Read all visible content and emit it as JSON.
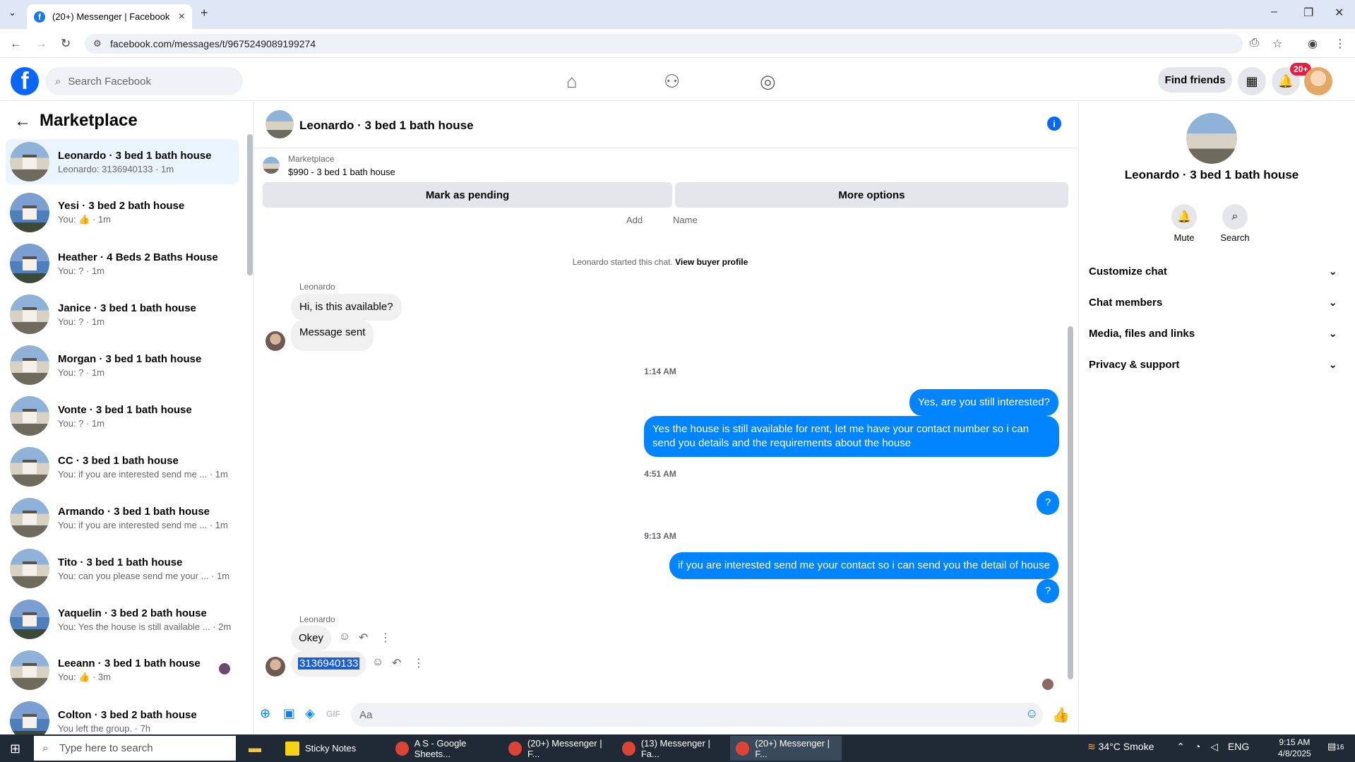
{
  "browser": {
    "tab_title": "(20+) Messenger | Facebook",
    "url": "facebook.com/messages/t/9675249089199274"
  },
  "header": {
    "search_placeholder": "Search Facebook",
    "find_friends": "Find friends",
    "notif_badge": "20+"
  },
  "left": {
    "title": "Marketplace",
    "conversations": [
      {
        "name": "Leonardo · 3 bed 1 bath house",
        "sub": "Leonardo: 3136940133 · 1m"
      },
      {
        "name": "Yesi · 3 bed 2 bath house",
        "sub": "You: 👍 · 1m"
      },
      {
        "name": "Heather · 4 Beds 2 Baths House",
        "sub": "You: ? · 1m"
      },
      {
        "name": "Janice · 3 bed 1 bath house",
        "sub": "You: ? · 1m"
      },
      {
        "name": "Morgan · 3 bed 1 bath house",
        "sub": "You: ? · 1m"
      },
      {
        "name": "Vonte · 3 bed 1 bath house",
        "sub": "You: ? · 1m"
      },
      {
        "name": "CC · 3 bed 1 bath house",
        "sub": "You: if you are interested send me ... · 1m"
      },
      {
        "name": "Armando · 3 bed 1 bath house",
        "sub": "You: if you are interested send me ... · 1m"
      },
      {
        "name": "Tito · 3 bed 1 bath house",
        "sub": "You: can you please send me your ... · 1m"
      },
      {
        "name": "Yaquelin · 3 bed 2 bath house",
        "sub": "You: Yes the house is still available ... · 2m"
      },
      {
        "name": "Leeann · 3 bed 1 bath house",
        "sub": "You: 👍 · 3m"
      },
      {
        "name": "Colton · 3 bed 2 bath house",
        "sub": "You left the group. · 7h"
      }
    ]
  },
  "chat": {
    "title": "Leonardo · 3 bed 1 bath house",
    "marketplace_label": "Marketplace",
    "listing": "$990 - 3 bed 1 bath house",
    "mark_pending": "Mark as pending",
    "more_options": "More options",
    "add": "Add",
    "name": "Name",
    "started_text": "Leonardo started this chat.",
    "view_buyer": "View buyer profile",
    "sender": "Leonardo",
    "msg1": "Hi, is this available?",
    "msg2": "Message sent",
    "time1": "1:14 AM",
    "out1": "Yes, are you still interested?",
    "out2": "Yes the house is still available for rent, let me have your contact number so i can send you details and the requirements about the house",
    "time2": "4:51 AM",
    "out3": "?",
    "time3": "9:13 AM",
    "out4": "if you are interested send me your contact so i can send you the detail of house",
    "out5": "?",
    "msg3": "Okey",
    "msg4": "3136940133",
    "composer_placeholder": "Aa"
  },
  "right": {
    "title": "Leonardo · 3 bed 1 bath house",
    "mute": "Mute",
    "search": "Search",
    "rows": [
      "Customize chat",
      "Chat members",
      "Media, files and links",
      "Privacy & support"
    ]
  },
  "taskbar": {
    "search": "Type here to search",
    "apps": [
      "Sticky Notes",
      "A S - Google Sheets...",
      "(20+) Messenger | F...",
      "(13) Messenger | Fa...",
      "(20+) Messenger | F..."
    ],
    "weather": "34°C  Smoke",
    "lang": "ENG",
    "time": "9:15 AM",
    "date": "4/8/2025",
    "notif_count": "16"
  },
  "colors": {
    "accent": "#0084ff",
    "brand": "#0866ff"
  }
}
